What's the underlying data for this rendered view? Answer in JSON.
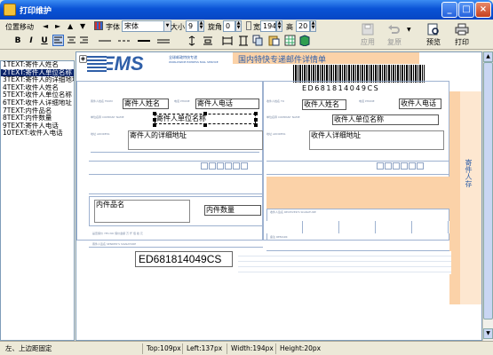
{
  "window": {
    "title": "打印维护",
    "min_label": "_",
    "max_label": "□",
    "close_label": "×"
  },
  "toolbar": {
    "move_label": "位置移动",
    "arrows": [
      "◄",
      "►",
      "▲",
      "▼"
    ],
    "font_label": "字体",
    "font_value": "宋体",
    "size_label": "大小",
    "size_value": "9",
    "rotate_label": "旋角",
    "rotate_value": "0",
    "width_label": "宽",
    "width_value": "194",
    "height_label": "高",
    "height_value": "20",
    "bold": "B",
    "italic": "I",
    "underline": "U",
    "apply_label": "应用",
    "restore_label": "复原",
    "preview_label": "预览",
    "print_label": "打印"
  },
  "fields": [
    "1TEXT:寄件人姓名",
    "2TEXT:寄件人单位名称",
    "3TEXT:寄件人的详细地址",
    "4TEXT:收件人姓名",
    "5TEXT:收件人单位名称",
    "6TEXT:收件人详细地址",
    "7TEXT:内件品名",
    "8TEXT:内件数量",
    "9TEXT:寄件人电话",
    "10TEXT:收件人电话"
  ],
  "form": {
    "ems_logo": "EMS",
    "ems_sub_cn": "全球邮政特快专递",
    "ems_sub_en": "WORLDWIDE EXPRESS MAIL SERVICE",
    "form_title": "国内特快专递邮件详情单",
    "barcode_text": "ED681814049CS",
    "bottom_code": "ED681814049CS",
    "side_label": "寄件人存",
    "sender_name": "寄件人姓名",
    "sender_phone": "寄件人电话",
    "sender_company": "寄件人单位名称",
    "sender_address": "寄件人的详细地址",
    "receiver_name": "收件人姓名",
    "receiver_phone": "收件人电话",
    "receiver_company": "收件人单位名称",
    "receiver_address": "收件人详细地址",
    "item_name": "内件品名",
    "item_qty": "内件数量"
  },
  "status": {
    "hint": "左、上边距固定",
    "top": "Top:109px",
    "left": "Left:137px",
    "width": "Width:194px",
    "height": "Height:20px"
  }
}
